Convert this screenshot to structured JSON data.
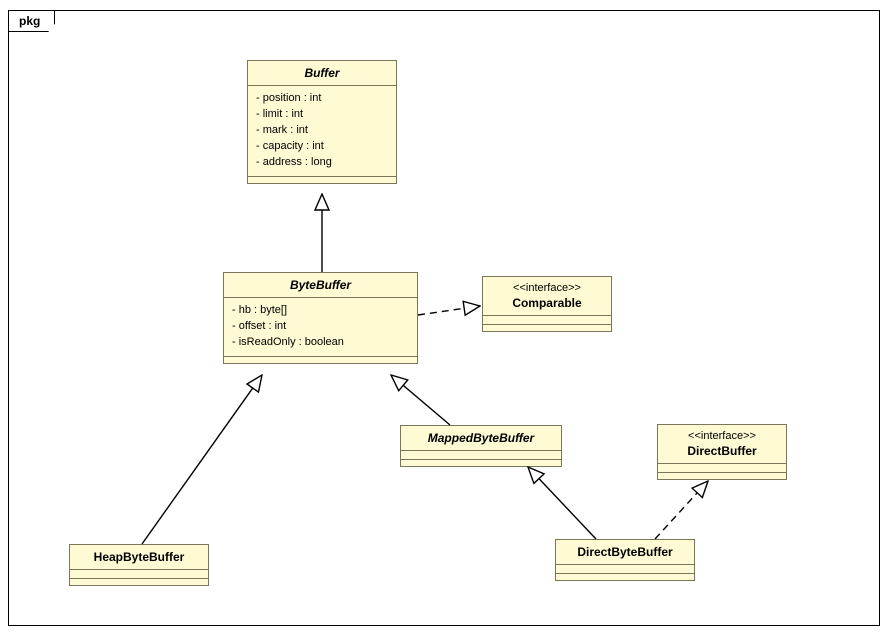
{
  "package": {
    "label": "pkg"
  },
  "classes": {
    "buffer": {
      "name": "Buffer",
      "attrs": [
        "- position : int",
        "- limit : int",
        "- mark : int",
        "- capacity : int",
        "- address : long"
      ]
    },
    "bytebuffer": {
      "name": "ByteBuffer",
      "attrs": [
        "- hb : byte[]",
        "- offset : int",
        "- isReadOnly : boolean"
      ]
    },
    "comparable": {
      "stereotype": "<<interface>>",
      "name": "Comparable"
    },
    "mappedbytebuffer": {
      "name": "MappedByteBuffer"
    },
    "directbuffer": {
      "stereotype": "<<interface>>",
      "name": "DirectBuffer"
    },
    "heapbytebuffer": {
      "name": "HeapByteBuffer"
    },
    "directbytebuffer": {
      "name": "DirectByteBuffer"
    }
  },
  "chart_data": {
    "type": "uml-class-diagram",
    "package": "pkg",
    "classes": [
      {
        "name": "Buffer",
        "abstract": true,
        "attributes": [
          "position:int",
          "limit:int",
          "mark:int",
          "capacity:int",
          "address:long"
        ]
      },
      {
        "name": "ByteBuffer",
        "abstract": true,
        "attributes": [
          "hb:byte[]",
          "offset:int",
          "isReadOnly:boolean"
        ]
      },
      {
        "name": "Comparable",
        "stereotype": "interface"
      },
      {
        "name": "MappedByteBuffer",
        "abstract": true
      },
      {
        "name": "DirectBuffer",
        "stereotype": "interface"
      },
      {
        "name": "HeapByteBuffer"
      },
      {
        "name": "DirectByteBuffer"
      }
    ],
    "relationships": [
      {
        "from": "ByteBuffer",
        "to": "Buffer",
        "type": "generalization"
      },
      {
        "from": "ByteBuffer",
        "to": "Comparable",
        "type": "realization"
      },
      {
        "from": "HeapByteBuffer",
        "to": "ByteBuffer",
        "type": "generalization"
      },
      {
        "from": "MappedByteBuffer",
        "to": "ByteBuffer",
        "type": "generalization"
      },
      {
        "from": "DirectByteBuffer",
        "to": "MappedByteBuffer",
        "type": "generalization"
      },
      {
        "from": "DirectByteBuffer",
        "to": "DirectBuffer",
        "type": "realization"
      }
    ]
  }
}
